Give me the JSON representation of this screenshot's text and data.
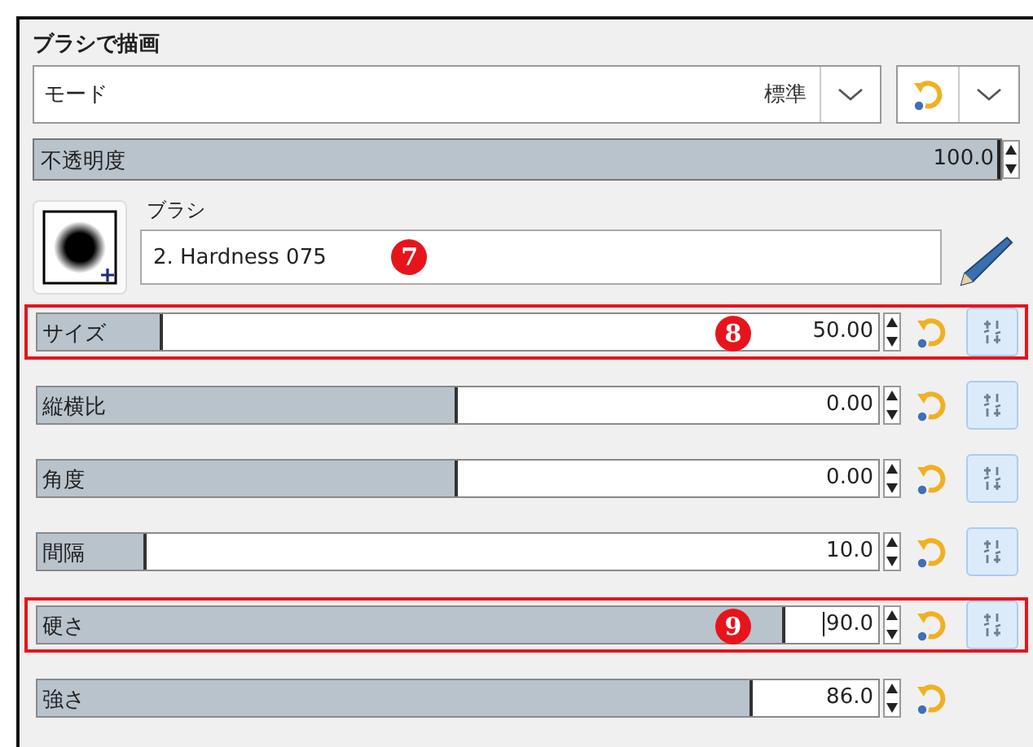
{
  "title": "ブラシで描画",
  "mode": {
    "label": "モード",
    "value": "標準"
  },
  "opacity": {
    "label": "不透明度",
    "value": "100.0",
    "level": 1
  },
  "brush": {
    "label": "ブラシ",
    "name": "2. Hardness 075",
    "badge": "7"
  },
  "sliders": [
    {
      "label": "サイズ",
      "value": "50.00",
      "level": 0.15,
      "chain_button": true,
      "highlighted": true,
      "badge": "8",
      "focused": false
    },
    {
      "label": "縦横比",
      "value": "0.00",
      "level": 0.5,
      "chain_button": true,
      "highlighted": false,
      "focused": false
    },
    {
      "label": "角度",
      "value": "0.00",
      "level": 0.5,
      "chain_button": true,
      "highlighted": false,
      "focused": false
    },
    {
      "label": "間隔",
      "value": "10.0",
      "level": 0.13,
      "chain_button": true,
      "highlighted": false,
      "focused": false
    },
    {
      "label": "硬さ",
      "value": "90.0",
      "level": 0.89,
      "chain_button": true,
      "highlighted": true,
      "badge": "9",
      "focused": true
    },
    {
      "label": "強さ",
      "value": "86.0",
      "level": 0.85,
      "chain_button": false,
      "highlighted": false,
      "focused": false
    }
  ]
}
